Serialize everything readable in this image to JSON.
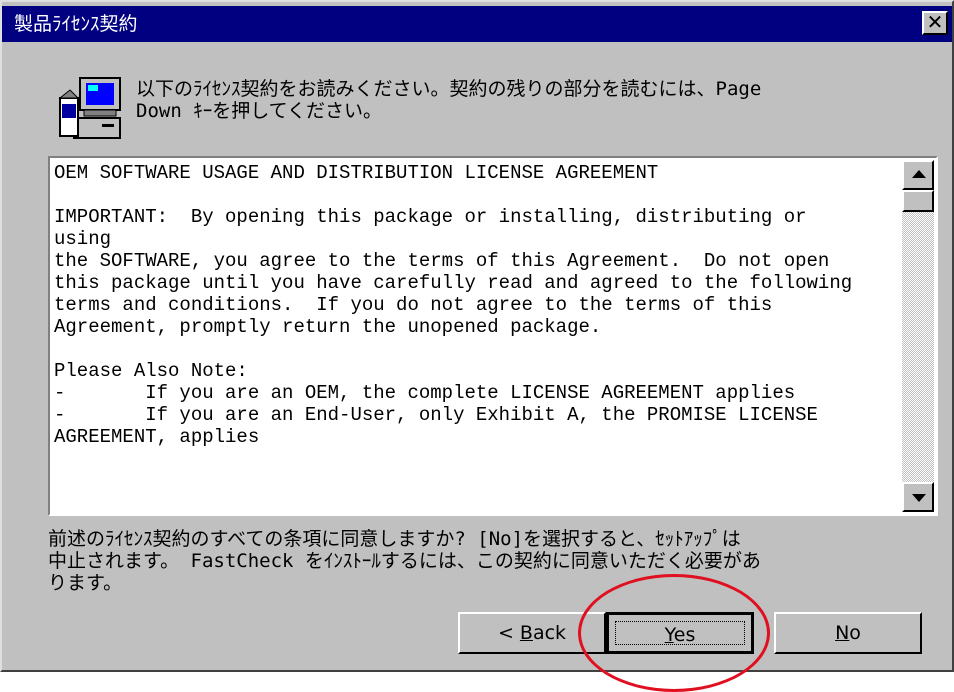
{
  "window": {
    "title": "製品ﾗｲｾﾝｽ契約",
    "close_label": "✕"
  },
  "icon": {
    "name": "setup-computer-icon"
  },
  "instruction": "以下のﾗｲｾﾝｽ契約をお読みください。契約の残りの部分を読むには、Page\nDown ｷｰを押してください。",
  "license": {
    "text": "OEM SOFTWARE USAGE AND DISTRIBUTION LICENSE AGREEMENT\n\nIMPORTANT:  By opening this package or installing, distributing or\nusing\nthe SOFTWARE, you agree to the terms of this Agreement.  Do not open\nthis package until you have carefully read and agreed to the following\nterms and conditions.  If you do not agree to the terms of this\nAgreement, promptly return the unopened package.\n\nPlease Also Note:\n-       If you are an OEM, the complete LICENSE AGREEMENT applies\n-       If you are an End-User, only Exhibit A, the PROMISE LICENSE\nAGREEMENT, applies"
  },
  "question": "前述のﾗｲｾﾝｽ契約のすべての条項に同意しますか?  [No]を選択すると、ｾｯﾄｱｯﾌﾟは\n中止されます。 FastCheck をｲﾝｽﾄｰﾙするには、この契約に同意いただく必要があ\nります。",
  "buttons": {
    "back_prefix": "< ",
    "back_key": "B",
    "back_rest": "ack",
    "yes_key": "Y",
    "yes_rest": "es",
    "no_key": "N",
    "no_rest": "o"
  },
  "colors": {
    "titlebar": "#000080",
    "face": "#c0c0c0",
    "highlight": "#e01020"
  }
}
